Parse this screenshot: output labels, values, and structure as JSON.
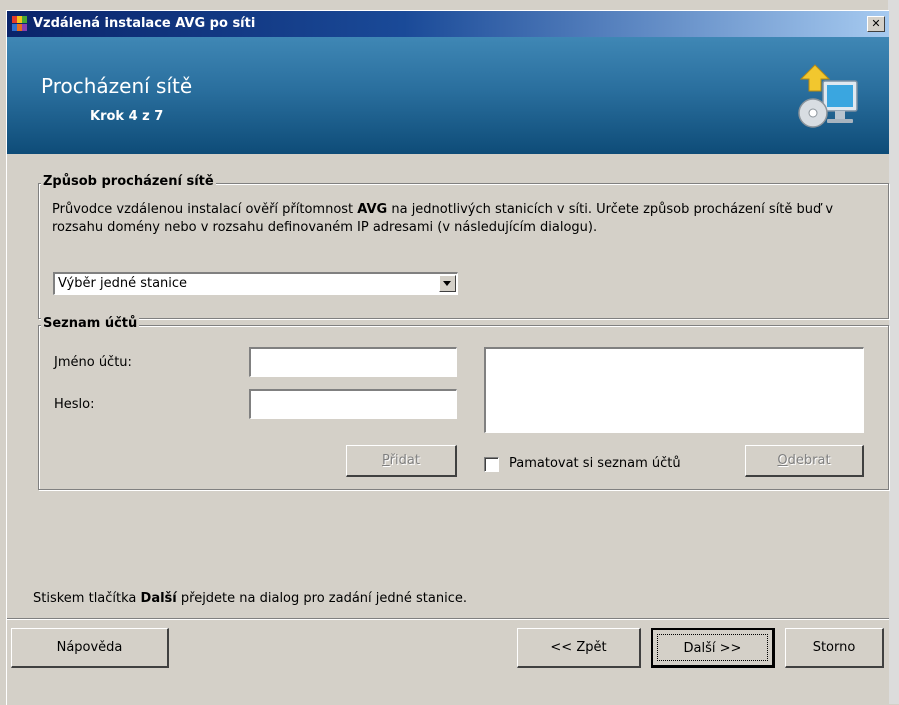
{
  "window": {
    "title": "Vzdálená instalace AVG po síti",
    "close_glyph": "✕"
  },
  "header": {
    "title": "Procházení sítě",
    "step": "Krok 4 z 7",
    "icon": "network-computer-icon"
  },
  "browse_group": {
    "legend": "Způsob procházení sítě",
    "description_part1": "Průvodce vzdálenou instalací ověří přítomnost ",
    "description_bold": "AVG",
    "description_part2": " na jednotlivých stanicích v síti. Určete způsob procházení sítě buď v rozsahu domény nebo v rozsahu definovaném IP adresami (v následujícím dialogu).",
    "combo_value": "Výběr jedné stanice"
  },
  "accounts_group": {
    "legend": "Seznam účtů",
    "account_name_label": "Jméno účtu:",
    "account_name_value": "",
    "password_label": "Heslo:",
    "password_value": "",
    "add_button_mnemonic": "P",
    "add_button_rest": "řidat",
    "remember_label": "Pamatovat si seznam účtů",
    "remember_checked": false,
    "remove_button_mnemonic": "O",
    "remove_button_rest": "debrat"
  },
  "hint": {
    "part1": "Stiskem tlačítka ",
    "bold": "Další",
    "part2": " přejdete na dialog pro zadání jedné stanice."
  },
  "footer": {
    "help": "Nápověda",
    "back": "<< Zpět",
    "next": "Další >>",
    "cancel": "Storno"
  },
  "colors": {
    "header_top": "#3f87b5",
    "header_bottom": "#0e4c78",
    "titlebar_start": "#0a246a",
    "titlebar_end": "#a6caf0",
    "dialog_bg": "#d4d0c8"
  }
}
